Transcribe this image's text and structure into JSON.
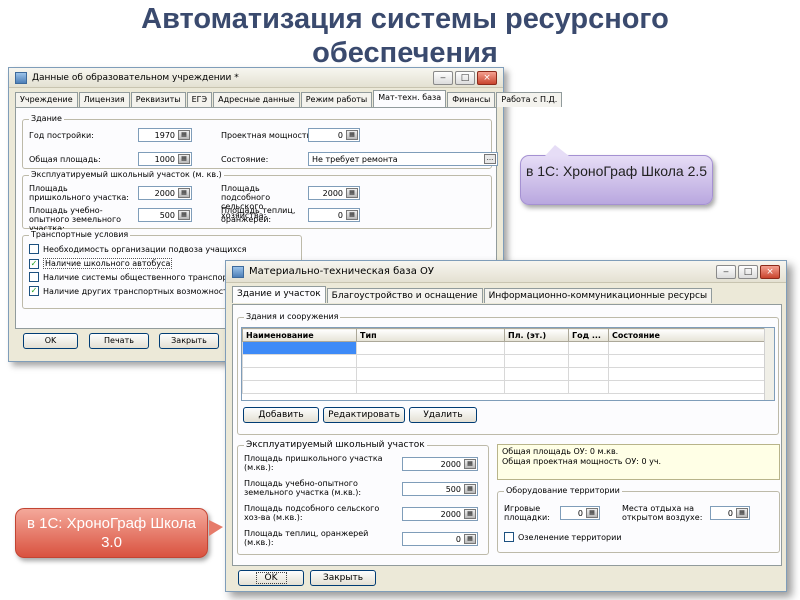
{
  "slide": {
    "title": "Автоматизация системы  ресурсного обеспечения"
  },
  "callouts": {
    "v25": "в 1С: ХроноГраф Школа 2.5",
    "v30": "в 1С: ХроноГраф Школа 3.0"
  },
  "window_a": {
    "title": "Данные об образовательном учреждении *",
    "tabs": [
      "Учреждение",
      "Лицензия",
      "Реквизиты",
      "ЕГЭ",
      "Адресные данные",
      "Режим работы",
      "Мат-техн. база",
      "Финансы",
      "Работа с П.Д."
    ],
    "active_tab": "Мат-техн. база",
    "building": {
      "label": "Здание",
      "year_label": "Год постройки:",
      "year_value": "1970",
      "capacity_label": "Проектная мощность:",
      "capacity_value": "0",
      "area_label": "Общая площадь:",
      "area_value": "1000",
      "state_label": "Состояние:",
      "state_value": "Не требует ремонта"
    },
    "plot": {
      "label": "Эксплуатируемый школьный участок (м. кв.)",
      "school_area_label": "Площадь пришкольного участка:",
      "school_area_value": "2000",
      "farm_label": "Площадь подсобного сельского хозяйства:",
      "farm_value": "2000",
      "training_label": "Площадь учебно-опытного земельного участка:",
      "training_value": "500",
      "greenhouse_label": "Площадь теплиц, оранжерей:",
      "greenhouse_value": "0"
    },
    "transport": {
      "label": "Транспортные условия",
      "items": [
        {
          "label": "Необходимость организации подвоза учащихся",
          "checked": false
        },
        {
          "label": "Наличие школьного автобуса",
          "checked": true
        },
        {
          "label": "Наличие системы общественного транспорта",
          "checked": false
        },
        {
          "label": "Наличие других транспортных возможностей",
          "checked": true
        }
      ]
    },
    "buttons": {
      "ok": "OK",
      "print": "Печать",
      "close": "Закрыть"
    }
  },
  "window_b": {
    "title": "Материально-техническая база ОУ",
    "tabs": [
      "Здание и участок",
      "Благоустройство и оснащение",
      "Информационно-коммуникационные ресурсы"
    ],
    "active_tab": "Здание и участок",
    "buildings": {
      "label": "Здания и сооружения",
      "columns": [
        "Наименование",
        "Тип",
        "Пл. (эт.)",
        "Год ...",
        "Состояние"
      ],
      "buttons": {
        "add": "Добавить",
        "edit": "Редактировать",
        "delete": "Удалить"
      }
    },
    "plot": {
      "label": "Эксплуатируемый школьный участок",
      "school_area_label": "Площадь пришкольного участка (м.кв.):",
      "school_area_value": "2000",
      "training_label": "Площадь учебно-опытного земельного участка (м.кв.):",
      "training_value": "500",
      "farm_label": "Площадь подсобного сельского хоз-ва (м.кв.):",
      "farm_value": "2000",
      "greenhouse_label": "Площадь теплиц, оранжерей (м.кв.):",
      "greenhouse_value": "0"
    },
    "info": {
      "line1": "Общая площадь ОУ: 0 м.кв.",
      "line2": "Общая проектная мощность ОУ: 0 уч."
    },
    "territory": {
      "label": "Оборудование территории",
      "playgrounds_label": "Игровые площадки:",
      "playgrounds_value": "0",
      "rest_label": "Места отдыха на открытом воздухе:",
      "rest_value": "0",
      "greening_label": "Озеленение территории",
      "greening_checked": false
    },
    "buttons": {
      "ok": "OK",
      "close": "Закрыть"
    }
  }
}
